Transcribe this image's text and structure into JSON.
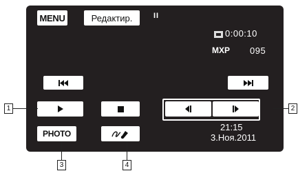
{
  "top": {
    "menu_label": "MENU",
    "edit_label": "Редактир.",
    "pause_indicator": "II"
  },
  "status": {
    "card_icon": "memory-card-icon",
    "timecode": "0:00:10",
    "quality": "MXP",
    "scene_number": "095"
  },
  "controls": {
    "skip_back_icon": "skip-to-previous-icon",
    "skip_forward_icon": "skip-to-next-icon",
    "play_icon": "play-icon",
    "stop_icon": "stop-icon",
    "frame_back_icon": "frame-reverse-icon",
    "frame_forward_icon": "frame-advance-icon",
    "photo_label": "PHOTO",
    "decoration_icon": "decoration-pen-icon"
  },
  "datetime": {
    "time": "21:15",
    "date": "3.Ноя.2011"
  },
  "callouts": [
    "1",
    "2",
    "3",
    "4"
  ]
}
